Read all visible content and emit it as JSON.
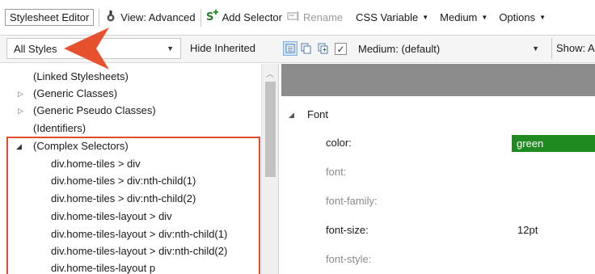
{
  "toolbar": {
    "title": "Stylesheet Editor",
    "view_label": "View: Advanced",
    "add_selector_label": "Add Selector",
    "rename_label": "Rename",
    "css_variable_label": "CSS Variable",
    "medium_label": "Medium",
    "options_label": "Options"
  },
  "filterbar": {
    "styles_combo_value": "All Styles",
    "hide_inherited_label": "Hide Inherited",
    "medium_checkbox_checked": true,
    "medium_combo_value": "Medium: (default)",
    "show_label": "Show: A"
  },
  "tree": {
    "items": [
      {
        "label": "(Linked Stylesheets)",
        "twisty": ""
      },
      {
        "label": "(Generic Classes)",
        "twisty": "collapsed"
      },
      {
        "label": "(Generic Pseudo Classes)",
        "twisty": "collapsed"
      },
      {
        "label": "(Identifiers)",
        "twisty": ""
      },
      {
        "label": "(Complex Selectors)",
        "twisty": "expanded"
      },
      {
        "label": "div.home-tiles > div",
        "twisty": ""
      },
      {
        "label": "div.home-tiles > div:nth-child(1)",
        "twisty": ""
      },
      {
        "label": "div.home-tiles > div:nth-child(2)",
        "twisty": ""
      },
      {
        "label": "div.home-tiles-layout > div",
        "twisty": ""
      },
      {
        "label": "div.home-tiles-layout > div:nth-child(1)",
        "twisty": ""
      },
      {
        "label": "div.home-tiles-layout > div:nth-child(2)",
        "twisty": ""
      },
      {
        "label": "div.home-tiles-layout p",
        "twisty": ""
      }
    ]
  },
  "properties": {
    "group_label": "Font",
    "rows": [
      {
        "name": "color:",
        "value": "green",
        "set": true
      },
      {
        "name": "font:",
        "value": "",
        "set": false
      },
      {
        "name": "font-family:",
        "value": "",
        "set": false
      },
      {
        "name": "font-size:",
        "value": "12pt",
        "set": true
      },
      {
        "name": "font-style:",
        "value": "",
        "set": false
      }
    ]
  },
  "colors": {
    "highlight_border": "#e24b2d",
    "callout_arrow": "#e8512d",
    "color_swatch": "#1f8a1f",
    "header_bar": "#8c8c8c"
  }
}
